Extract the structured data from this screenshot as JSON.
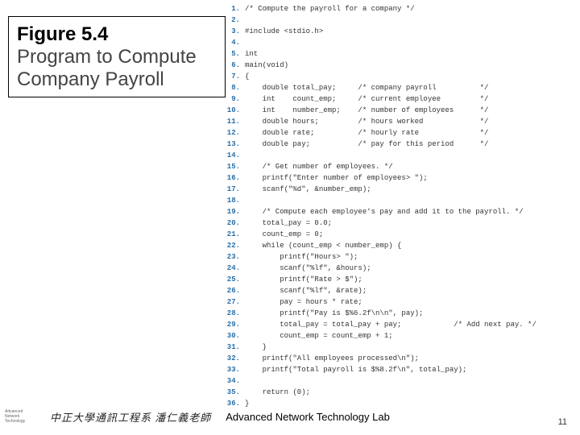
{
  "title": {
    "figure": "Figure 5.4",
    "desc": "Program to Compute Company Payroll"
  },
  "footer": {
    "zh": "中正大學通訊工程系 潘仁義老師",
    "en": "Advanced Network Technology Lab",
    "page": "11",
    "logo1": "Advanced",
    "logo2": "Network",
    "logo3": "Technology"
  },
  "code": [
    "/* Compute the payroll for a company */",
    "",
    "#include <stdio.h>",
    "",
    "int",
    "main(void)",
    "{",
    "    double total_pay;     /* company payroll          */",
    "    int    count_emp;     /* current employee         */",
    "    int    number_emp;    /* number of employees      */",
    "    double hours;         /* hours worked             */",
    "    double rate;          /* hourly rate              */",
    "    double pay;           /* pay for this period      */",
    "",
    "    /* Get number of employees. */",
    "    printf(\"Enter number of employees> \");",
    "    scanf(\"%d\", &number_emp);",
    "",
    "    /* Compute each employee's pay and add it to the payroll. */",
    "    total_pay = 0.0;",
    "    count_emp = 0;",
    "    while (count_emp < number_emp) {",
    "        printf(\"Hours> \");",
    "        scanf(\"%lf\", &hours);",
    "        printf(\"Rate > $\");",
    "        scanf(\"%lf\", &rate);",
    "        pay = hours * rate;",
    "        printf(\"Pay is $%6.2f\\n\\n\", pay);",
    "        total_pay = total_pay + pay;            /* Add next pay. */",
    "        count_emp = count_emp + 1;",
    "    }",
    "    printf(\"All employees processed\\n\");",
    "    printf(\"Total payroll is $%8.2f\\n\", total_pay);",
    "",
    "    return (0);",
    "}"
  ]
}
